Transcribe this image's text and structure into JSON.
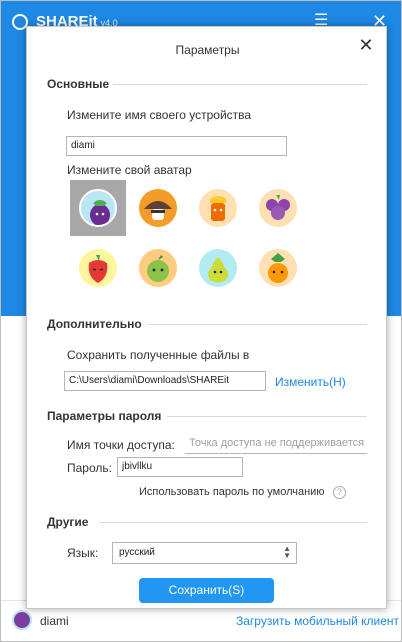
{
  "app": {
    "title": "SHAREit",
    "version": "v4.0",
    "user_name": "diami",
    "download_link": "Загрузить мобильный клиент",
    "colors": {
      "accent": "#1e88e5",
      "button": "#2196f3"
    }
  },
  "dialog": {
    "title": "Параметры",
    "close_icon": "close-icon",
    "sections": {
      "basic": {
        "title": "Основные",
        "device_name_label": "Измените имя своего устройства",
        "device_name_value": "diami",
        "avatar_label": "Измените свой аватар",
        "avatars": [
          {
            "name": "eggplant-avatar",
            "selected": true
          },
          {
            "name": "mushroom-avatar",
            "selected": false
          },
          {
            "name": "carrot-avatar",
            "selected": false
          },
          {
            "name": "grapes-avatar",
            "selected": false
          },
          {
            "name": "pepper-avatar",
            "selected": false
          },
          {
            "name": "apple-avatar",
            "selected": false
          },
          {
            "name": "pear-avatar",
            "selected": false
          },
          {
            "name": "pineapple-avatar",
            "selected": false
          }
        ]
      },
      "additional": {
        "title": "Дополнительно",
        "save_path_label": "Сохранить полученные файлы в",
        "save_path_value": "C:\\Users\\diami\\Downloads\\SHAREit",
        "change_link": "Изменить(H)"
      },
      "password": {
        "title": "Параметры пароля",
        "hotspot_label": "Имя точки доступа:",
        "hotspot_placeholder": "Точка доступа не поддерживается",
        "password_label": "Пароль:",
        "password_value": "jbivllku",
        "default_password_label": "Использовать пароль по умолчанию"
      },
      "other": {
        "title": "Другие",
        "language_label": "Язык:",
        "language_value": "русский"
      }
    },
    "save_button": "Сохранить(S)"
  }
}
